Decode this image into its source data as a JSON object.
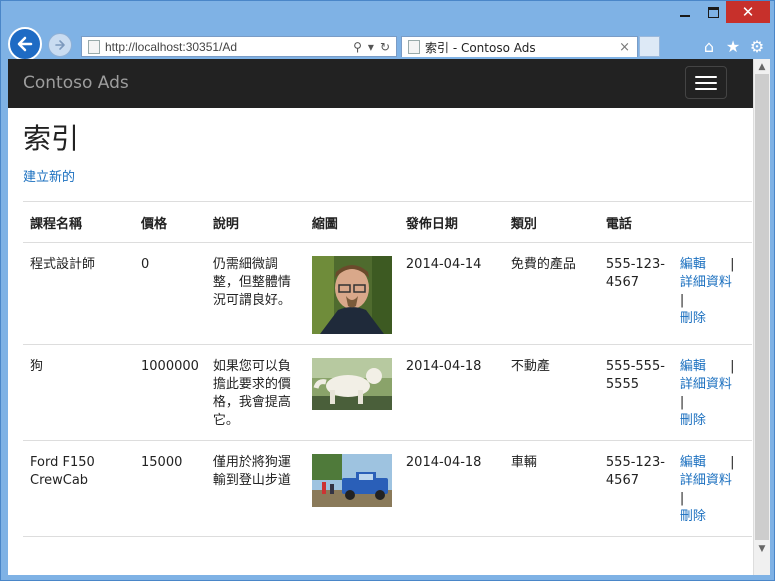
{
  "browser": {
    "window_controls": {
      "minimize": "—",
      "maximize": "□",
      "close": "✕"
    },
    "address": {
      "url": "http://localhost:30351/Ad"
    },
    "tab": {
      "title": "索引 - Contoso Ads",
      "close": "×"
    },
    "icons": [
      "home-icon",
      "star-icon",
      "gear-icon"
    ]
  },
  "navbar": {
    "brand": "Contoso Ads"
  },
  "page": {
    "heading": "索引",
    "create_link": "建立新的",
    "columns": [
      "課程名稱",
      "價格",
      "說明",
      "縮圖",
      "發佈日期",
      "類別",
      "電話"
    ],
    "rows": [
      {
        "title": "程式設計師",
        "price": "0",
        "description": "仍需細微調整，但整體情況可謂良好。",
        "thumbnail": "man-portrait",
        "date": "2014-04-14",
        "category": "免費的產品",
        "phone": "555-123-4567",
        "edit": "編輯",
        "sep": "|",
        "details": "詳細資料",
        "delete": "刪除"
      },
      {
        "title": "狗",
        "price": "1000000",
        "description": "如果您可以負擔此要求的價格，我會提高它。",
        "thumbnail": "white-dog",
        "date": "2014-04-18",
        "category": "不動產",
        "phone": "555-555-5555",
        "edit": "編輯",
        "sep": "|",
        "details": "詳細資料",
        "delete": "刪除"
      },
      {
        "title": "Ford F150 CrewCab",
        "price": "15000",
        "description": "僅用於將狗運輸到登山步道",
        "thumbnail": "blue-truck",
        "date": "2014-04-18",
        "category": "車輛",
        "phone": "555-123-4567",
        "edit": "編輯",
        "sep": "|",
        "details": "詳細資料",
        "delete": "刪除"
      }
    ]
  },
  "colors": {
    "navbar": "#222222",
    "link": "#1a6fbf",
    "close": "#c7302b",
    "chrome": "#7fb2e5"
  }
}
